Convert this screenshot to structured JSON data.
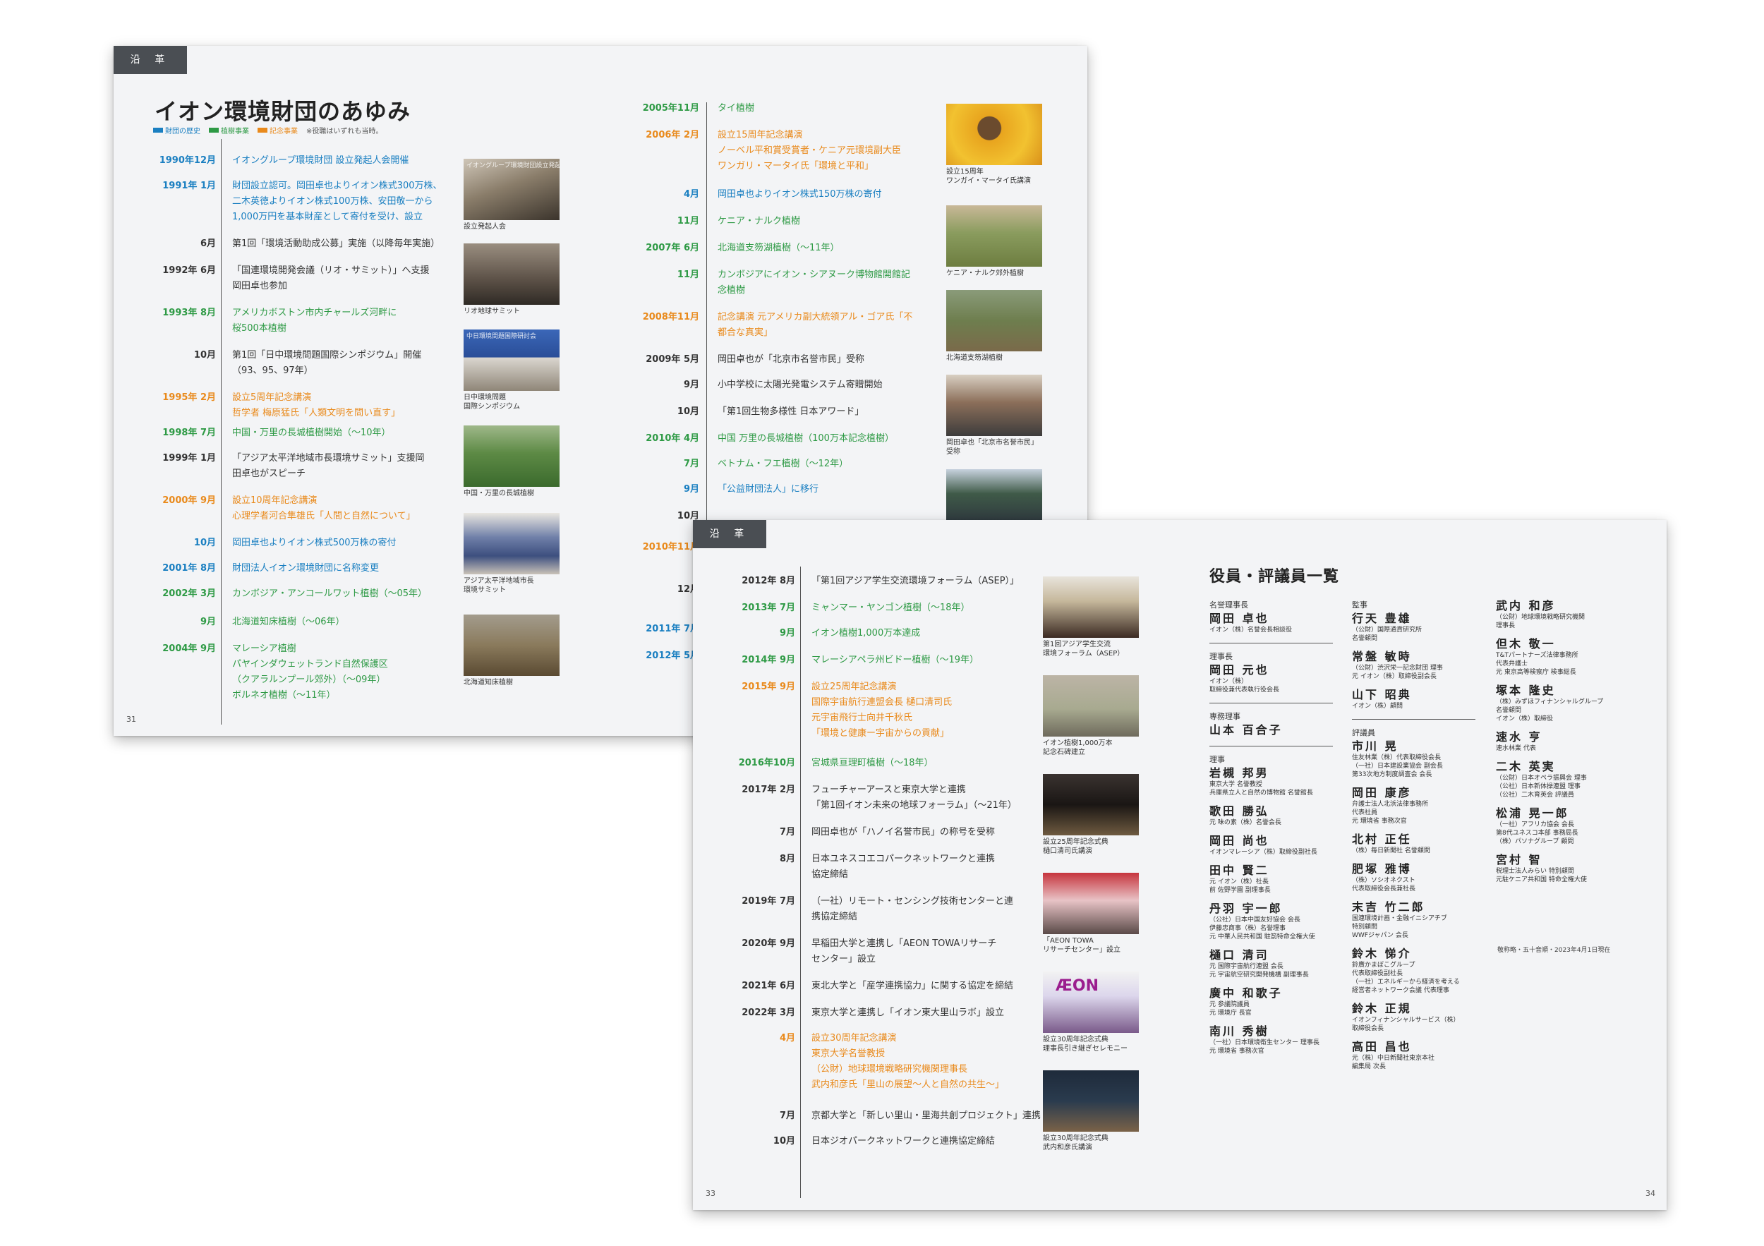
{
  "section_tag": "沿 革",
  "page1": {
    "title": "イオン環境財団のあゆみ",
    "legend": [
      {
        "label": "財団の歴史",
        "color": "#1a7fc1"
      },
      {
        "label": "植樹事業",
        "color": "#2e9a45"
      },
      {
        "label": "記念事業",
        "color": "#e98a1c"
      }
    ],
    "legend_note": "※役職はいずれも当時。",
    "page_number": "31",
    "timeline": [
      {
        "date": "1990年12月",
        "color": "blue",
        "lines": [
          "イオングループ環境財団 設立発起人会開催"
        ]
      },
      {
        "date": "1991年 1月",
        "color": "blue",
        "lines": [
          "財団設立認可。岡田卓也よりイオン株式300万株、",
          "二木英徳よりイオン株式100万株、安田敬一から",
          "1,000万円を基本財産として寄付を受け、設立"
        ]
      },
      {
        "date": "6月",
        "color": "black",
        "lines": [
          "第1回「環境活動助成公募」実施（以降毎年実施）"
        ]
      },
      {
        "date": "1992年 6月",
        "color": "black",
        "lines": [
          "「国連環境開発会議（リオ・サミット）」へ支援",
          "岡田卓也参加"
        ]
      },
      {
        "date": "1993年 8月",
        "color": "green",
        "lines": [
          "アメリカボストン市内チャールズ河畔に",
          "桜500本植樹"
        ]
      },
      {
        "date": "10月",
        "color": "black",
        "lines": [
          "第1回「日中環境問題国際シンポジウム」開催",
          "（93、95、97年）"
        ]
      },
      {
        "date": "1995年 2月",
        "color": "orange",
        "lines": [
          "設立5周年記念講演",
          "哲学者 梅原猛氏「人類文明を問い直す」"
        ]
      },
      {
        "date": "1998年 7月",
        "color": "green",
        "lines": [
          "中国・万里の長城植樹開始（〜10年）"
        ]
      },
      {
        "date": "1999年 1月",
        "color": "black",
        "lines": [
          "「アジア太平洋地域市長環境サミット」支援岡",
          "田卓也がスピーチ"
        ]
      },
      {
        "date": "2000年 9月",
        "color": "orange",
        "lines": [
          "設立10周年記念講演",
          "心理学者河合隼雄氏「人間と自然について」"
        ]
      },
      {
        "date": "10月",
        "color": "blue",
        "lines": [
          "岡田卓也よりイオン株式500万株の寄付"
        ]
      },
      {
        "date": "2001年 8月",
        "color": "blue",
        "lines": [
          "財団法人イオン環境財団に名称変更"
        ]
      },
      {
        "date": "2002年 3月",
        "color": "green",
        "lines": [
          "カンボジア・アンコールワット植樹（〜05年）"
        ]
      },
      {
        "date": "9月",
        "color": "green",
        "lines": [
          "北海道知床植樹（〜06年）"
        ]
      },
      {
        "date": "2004年 9月",
        "color": "green",
        "lines": [
          "マレーシア植樹",
          "パヤインダウェットランド自然保護区",
          "（クアラルンプール郊外）（〜09年）",
          "ボルネオ植樹（〜11年）"
        ]
      }
    ],
    "photos": [
      {
        "caption": [
          "設立発起人会"
        ],
        "img_text": "イオングループ環境財団設立発起人会"
      },
      {
        "caption": [
          "リオ地球サミット"
        ]
      },
      {
        "caption": [
          "日中環境問題",
          "国際シンポジウム"
        ],
        "img_text": "中日環境問題国際研討会"
      },
      {
        "caption": [
          "中国・万里の長城植樹"
        ]
      },
      {
        "caption": [
          "アジア太平洋地域市長",
          "環境サミット"
        ]
      },
      {
        "caption": [
          "北海道知床植樹"
        ]
      }
    ]
  },
  "page2": {
    "timeline": [
      {
        "date": "2005年11月",
        "color": "green",
        "lines": [
          "タイ植樹"
        ]
      },
      {
        "date": "2006年 2月",
        "color": "orange",
        "lines": [
          "設立15周年記念講演",
          "ノーベル平和賞受賞者・ケニア元環境副大臣",
          "ワンガリ・マータイ氏「環境と平和」"
        ]
      },
      {
        "date": "4月",
        "color": "blue",
        "lines": [
          "岡田卓也よりイオン株式150万株の寄付"
        ]
      },
      {
        "date": "11月",
        "color": "green",
        "lines": [
          "ケニア・ナルク植樹"
        ]
      },
      {
        "date": "2007年 6月",
        "color": "green",
        "lines": [
          "北海道支笏湖植樹（〜11年）"
        ]
      },
      {
        "date": "11月",
        "color": "green",
        "lines": [
          "カンボジアにイオン・シアヌーク博物館開館記",
          "念植樹"
        ]
      },
      {
        "date": "2008年11月",
        "color": "orange",
        "lines": [
          "記念講演 元アメリカ副大統領アル・ゴア氏「不",
          "都合な真実」"
        ]
      },
      {
        "date": "2009年 5月",
        "color": "black",
        "lines": [
          "岡田卓也が「北京市名誉市民」受称"
        ]
      },
      {
        "date": "9月",
        "color": "black",
        "lines": [
          "小中学校に太陽光発電システム寄贈開始"
        ]
      },
      {
        "date": "10月",
        "color": "black",
        "lines": [
          "「第1回生物多様性 日本アワード」"
        ]
      },
      {
        "date": "2010年 4月",
        "color": "green",
        "lines": [
          "中国 万里の長城植樹（100万本記念植樹）"
        ]
      },
      {
        "date": "7月",
        "color": "green",
        "lines": [
          "ベトナム・フエ植樹（〜12年）"
        ]
      },
      {
        "date": "9月",
        "color": "blue",
        "lines": [
          "「公益財団法人」に移行"
        ]
      }
    ],
    "hidden_dates": [
      "10月",
      "2010年11月",
      "12月",
      "2011年 7月",
      "2012年 5月"
    ],
    "photos": [
      {
        "caption": [
          "設立15周年",
          "ワンガイ・マータイ氏講演"
        ]
      },
      {
        "caption": [
          "ケニア・ナルク郊外植樹"
        ]
      },
      {
        "caption": [
          "北海道支笏湖植樹"
        ]
      },
      {
        "caption": [
          "岡田卓也「北京市名誉市民」",
          "受称"
        ]
      },
      {
        "caption": []
      }
    ]
  },
  "page3": {
    "page_number": "33",
    "timeline": [
      {
        "date": "2012年 8月",
        "color": "black",
        "lines": [
          "「第1回アジア学生交流環境フォーラム（ASEP）」"
        ]
      },
      {
        "date": "2013年 7月",
        "color": "green",
        "lines": [
          "ミャンマー・ヤンゴン植樹（〜18年）"
        ]
      },
      {
        "date": "9月",
        "color": "green",
        "lines": [
          "イオン植樹1,000万本達成"
        ]
      },
      {
        "date": "2014年 9月",
        "color": "green",
        "lines": [
          "マレーシアペラ州ビドー植樹（〜19年）"
        ]
      },
      {
        "date": "2015年 9月",
        "color": "orange",
        "lines": [
          "設立25周年記念講演",
          "国際宇宙航行連盟会長 樋口清司氏",
          "元宇宙飛行士向井千秋氏",
          "「環境と健康ー宇宙からの貢献」"
        ]
      },
      {
        "date": "2016年10月",
        "color": "green",
        "lines": [
          "宮城県亘理町植樹（〜18年）"
        ]
      },
      {
        "date": "2017年 2月",
        "color": "black",
        "lines": [
          "フューチャーアースと東京大学と連携",
          "「第1回イオン未来の地球フォーラム」（〜21年）"
        ]
      },
      {
        "date": "7月",
        "color": "black",
        "lines": [
          "岡田卓也が「ハノイ名誉市民」の称号を受称"
        ]
      },
      {
        "date": "8月",
        "color": "black",
        "lines": [
          "日本ユネスコエコパークネットワークと連携",
          "協定締結"
        ]
      },
      {
        "date": "2019年 7月",
        "color": "black",
        "lines": [
          "（一社）リモート・センシング技術センターと連",
          "携協定締結"
        ]
      },
      {
        "date": "2020年 9月",
        "color": "black",
        "lines": [
          "早稲田大学と連携し「AEON TOWAリサーチ",
          "センター」設立"
        ]
      },
      {
        "date": "2021年 6月",
        "color": "black",
        "lines": [
          "東北大学と「産学連携協力」に関する協定を締結"
        ]
      },
      {
        "date": "2022年 3月",
        "color": "black",
        "lines": [
          "東京大学と連携し「イオン東大里山ラボ」設立"
        ]
      },
      {
        "date": "4月",
        "color": "orange",
        "lines": [
          "設立30周年記念講演",
          "東京大学名誉教授",
          "（公財）地球環境戦略研究機関理事長",
          "武内和彦氏「里山の展望〜人と自然の共生〜」"
        ]
      },
      {
        "date": "7月",
        "color": "black",
        "lines": [
          "京都大学と「新しい里山・里海共創プロジェクト」連携"
        ]
      },
      {
        "date": "10月",
        "color": "black",
        "lines": [
          "日本ジオパークネットワークと連携協定締結"
        ]
      }
    ],
    "photos": [
      {
        "caption": [
          "第1回アジア学生交流",
          "環境フォーラム（ASEP）"
        ]
      },
      {
        "caption": [
          "イオン植樹1,000万本",
          "記念石碑建立"
        ]
      },
      {
        "caption": [
          "設立25周年記念式典",
          "樋口清司氏講演"
        ]
      },
      {
        "caption": [
          "「AEON TOWA",
          "リサーチセンター」設立"
        ]
      },
      {
        "caption": [
          "設立30周年記念式典",
          "理事長引き継ぎセレモニー"
        ],
        "img_text": "ÆON"
      },
      {
        "caption": [
          "設立30周年記念式典",
          "武内和彦氏講演"
        ]
      }
    ]
  },
  "page4": {
    "title": "役員・評議員一覧",
    "page_number": "34",
    "as_of": "敬称略・五十音順・2023年4月1日現在",
    "col1": [
      {
        "role": "名誉理事長",
        "name": "岡田 卓也",
        "aff": [
          "イオン（株）名誉会長相談役"
        ],
        "sep_after": true
      },
      {
        "role": "理事長",
        "name": "岡田 元也",
        "aff": [
          "イオン（株）",
          "取締役兼代表執行役会長"
        ],
        "sep_after": true
      },
      {
        "role": "専務理事",
        "name": "山本 百合子",
        "aff": [],
        "sep_after": true
      },
      {
        "role": "理事",
        "name": "岩槻 邦男",
        "aff": [
          "東京大学 名誉教授",
          "兵庫県立人と自然の博物館 名誉館長"
        ]
      },
      {
        "name": "歌田 勝弘",
        "aff": [
          "元 味の素（株）名誉会長"
        ]
      },
      {
        "name": "岡田 尚也",
        "aff": [
          "イオンマレーシア（株）取締役副社長"
        ]
      },
      {
        "name": "田中 賢二",
        "aff": [
          "元 イオン（株）社長",
          "前 佐野学園 副理事長"
        ]
      },
      {
        "name": "丹羽 宇一郎",
        "aff": [
          "（公社）日本中国友好協会 会長",
          "伊藤忠商事（株）名誉理事",
          "元 中華人民共和国 駐箚特命全権大使"
        ]
      },
      {
        "name": "樋口 清司",
        "aff": [
          "元 国際宇宙航行連盟 会長",
          "元 宇宙航空研究開発機構 副理事長"
        ]
      },
      {
        "name": "廣中 和歌子",
        "aff": [
          "元 参議院議員",
          "元 環境庁 長官"
        ]
      },
      {
        "name": "南川 秀樹",
        "aff": [
          "（一社）日本環境衛生センター 理事長",
          "元 環境省 事務次官"
        ]
      }
    ],
    "col2": [
      {
        "role": "監事",
        "name": "行天 豊雄",
        "aff": [
          "（公財）国際通貨研究所",
          "名誉顧問"
        ]
      },
      {
        "name": "常盤 敏時",
        "aff": [
          "（公財）渋沢栄一記念財団 理事",
          "元 イオン（株）取締役副会長"
        ]
      },
      {
        "name": "山下 昭典",
        "aff": [
          "イオン（株）顧問"
        ],
        "sep_after": true
      },
      {
        "role": "評議員",
        "name": "市川 晃",
        "aff": [
          "住友林業（株）代表取締役会長",
          "（一社）日本建設業協会 副会長",
          "第33次地方制度調査会 会長"
        ]
      },
      {
        "name": "岡田 康彦",
        "aff": [
          "弁護士法人北浜法律事務所",
          "代表社員",
          "元 環境省 事務次官"
        ]
      },
      {
        "name": "北村 正任",
        "aff": [
          "（株）毎日新聞社 名誉顧問"
        ]
      },
      {
        "name": "肥塚 雅博",
        "aff": [
          "（株）ソシオネクスト",
          "代表取締役会長兼社長"
        ]
      },
      {
        "name": "末吉 竹二郎",
        "aff": [
          "国連環境計画・金融イニシアチブ",
          "特別顧問",
          "WWFジャパン 会長"
        ]
      },
      {
        "name": "鈴木 悌介",
        "aff": [
          "鈴廣かまぼこグループ",
          "代表取締役副社長",
          "（一社）エネルギーから経済を考える",
          "経営者ネットワーク会議 代表理事"
        ]
      },
      {
        "name": "鈴木 正規",
        "aff": [
          "イオンフィナンシャルサービス（株）",
          "取締役会長"
        ]
      },
      {
        "name": "高田 昌也",
        "aff": [
          "元（株）中日新聞社東京本社",
          "編集局 次長"
        ]
      }
    ],
    "col3": [
      {
        "name": "武内 和彦",
        "aff": [
          "（公財）地球環境戦略研究機関",
          "理事長"
        ]
      },
      {
        "name": "但木 敬一",
        "aff": [
          "T&Tパートナーズ法律事務所",
          "代表弁護士",
          "元 東京高等検察庁 検事総長"
        ]
      },
      {
        "name": "塚本 隆史",
        "aff": [
          "（株）みずほフィナンシャルグループ",
          "名誉顧問",
          "イオン（株）取締役"
        ]
      },
      {
        "name": "速水 亨",
        "aff": [
          "速水林業 代表"
        ]
      },
      {
        "name": "二木 英実",
        "aff": [
          "（公財）日本オペラ振興会 理事",
          "（公社）日本新体操連盟 理事",
          "（公社）二木育英会 評議員"
        ]
      },
      {
        "name": "松浦 晃一郎",
        "aff": [
          "（一社）アフリカ協会 会長",
          "第8代ユネスコ本部 事務局長",
          "（株）パソナグループ 顧問"
        ]
      },
      {
        "name": "宮村 智",
        "aff": [
          "税理士法人みらい 特別顧問",
          "元駐ケニア共和国 特命全権大使"
        ]
      }
    ]
  }
}
